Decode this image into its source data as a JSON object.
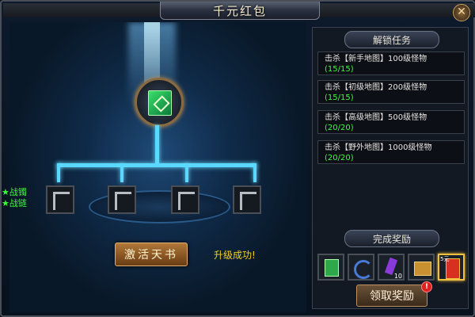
{
  "window": {
    "title": "千元红包",
    "close_label": "✕"
  },
  "left": {
    "attributes": [
      {
        "label": "★战镯"
      },
      {
        "label": "★战链"
      }
    ],
    "activate_label": "激活天书",
    "upgrade_message": "升级成功!"
  },
  "tasks": {
    "header": "解锁任务",
    "items": [
      {
        "text": "击杀【新手地图】100级怪物",
        "progress": "(15/15)"
      },
      {
        "text": "击杀【初级地图】200级怪物",
        "progress": "(15/15)"
      },
      {
        "text": "击杀【高级地图】500级怪物",
        "progress": "(20/20)"
      },
      {
        "text": "击杀【野外地图】1000级怪物",
        "progress": "(20/20)"
      }
    ]
  },
  "rewards": {
    "header": "完成奖励",
    "items": [
      {
        "icon": "green-book-icon",
        "count": "",
        "tag": "",
        "color": "#2ea84a"
      },
      {
        "icon": "blue-crescent-icon",
        "count": "",
        "tag": "",
        "color": "#4a7ad8"
      },
      {
        "icon": "purple-crystal-icon",
        "count": "10",
        "tag": "",
        "color": "#8a3ad8"
      },
      {
        "icon": "gold-chest-icon",
        "count": "",
        "tag": "",
        "color": "#c89030"
      },
      {
        "icon": "red-envelope-icon",
        "count": "",
        "tag": "5元",
        "color": "#d83020"
      }
    ],
    "claim_label": "领取奖励",
    "alert_mark": "!"
  }
}
